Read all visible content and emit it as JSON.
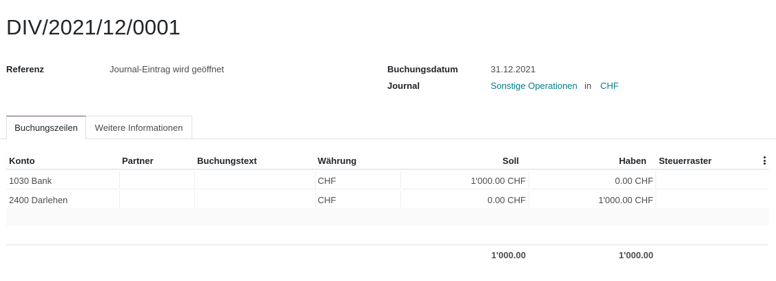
{
  "record": {
    "title": "DIV/2021/12/0001"
  },
  "fields": {
    "ref_label": "Referenz",
    "ref_value": "Journal-Eintrag wird geöffnet",
    "date_label": "Buchungsdatum",
    "date_value": "31.12.2021",
    "journal_label": "Journal",
    "journal_value": "Sonstige Operationen",
    "journal_in": "in",
    "currency_value": "CHF"
  },
  "tabs": [
    {
      "label": "Buchungszeilen"
    },
    {
      "label": "Weitere Informationen"
    }
  ],
  "table": {
    "headers": [
      "Konto",
      "Partner",
      "Buchungstext",
      "Währung",
      "Soll",
      "Haben",
      "Steuerraster"
    ],
    "rows": [
      [
        "1030 Bank",
        "",
        "",
        "CHF",
        "1'000.00 CHF",
        "0.00 CHF",
        ""
      ],
      [
        "2400 Darlehen",
        "",
        "",
        "CHF",
        "0.00 CHF",
        "1'000.00 CHF",
        ""
      ]
    ],
    "totals": {
      "debit": "1'000.00",
      "credit": "1'000.00"
    }
  },
  "icons": {
    "column_options": "vertical-ellipsis-icon"
  },
  "colors": {
    "link": "#017e84",
    "active_tab": "#714b67"
  }
}
